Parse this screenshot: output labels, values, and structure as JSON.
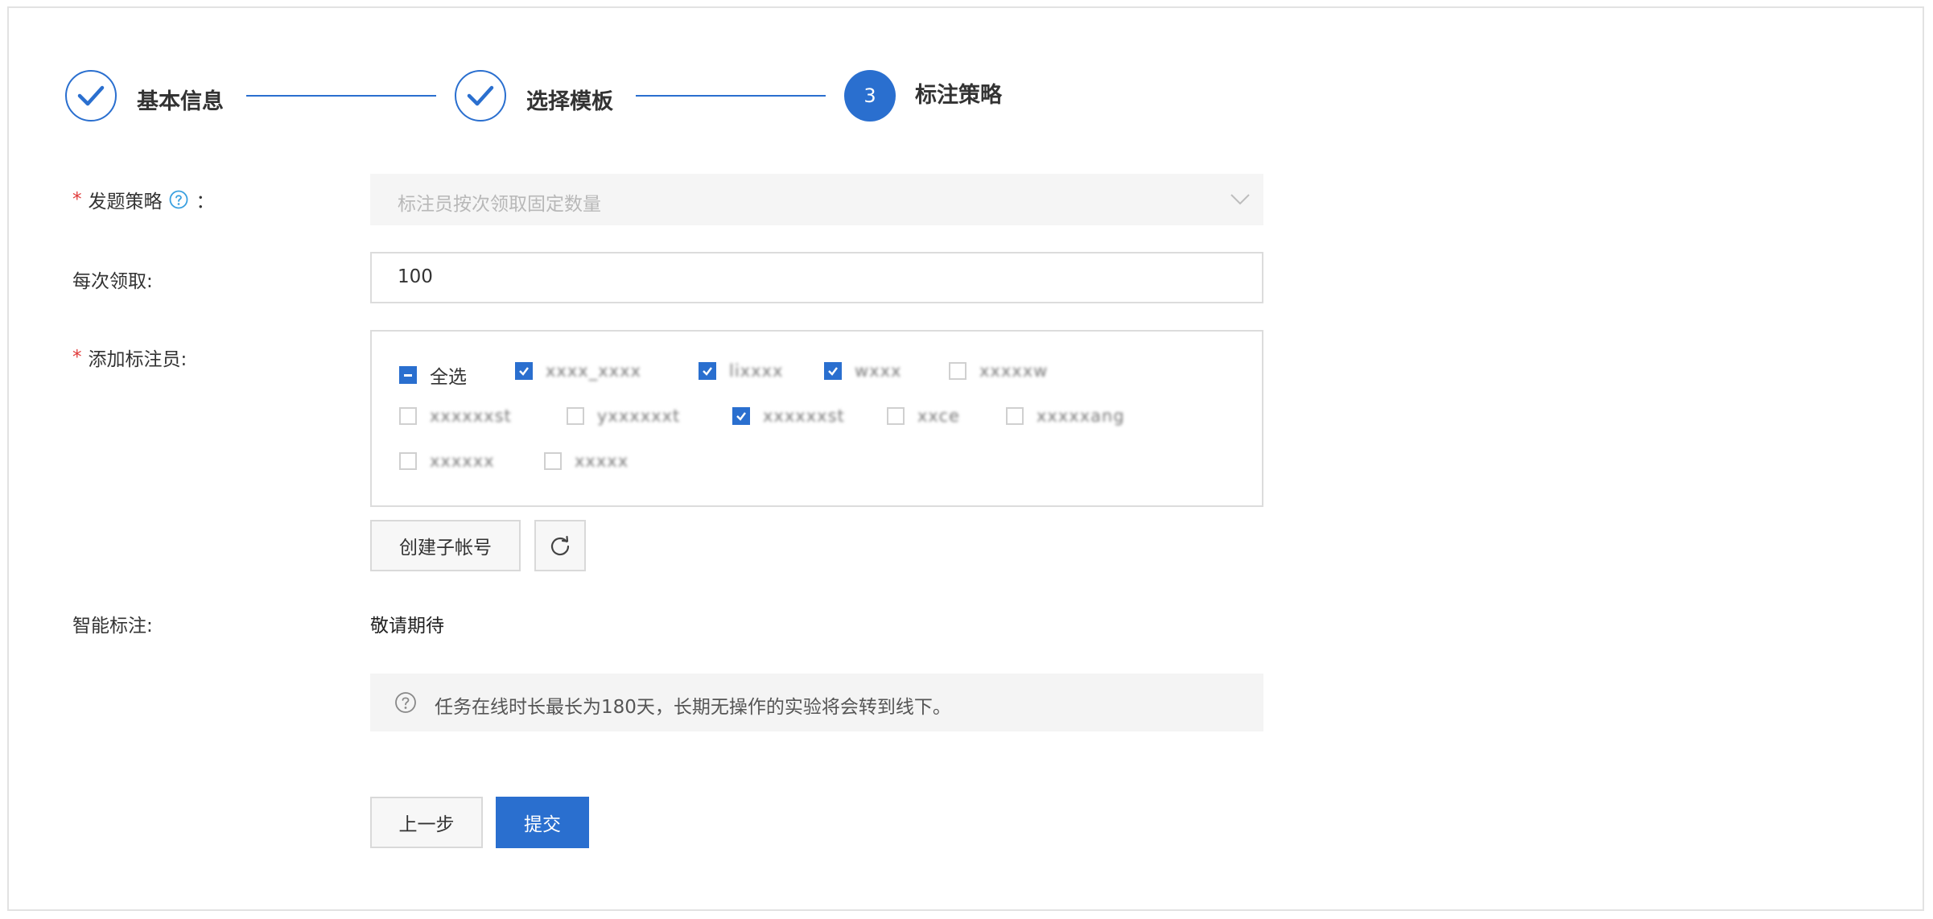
{
  "steps": [
    {
      "label": "基本信息",
      "status": "done"
    },
    {
      "label": "选择模板",
      "status": "done"
    },
    {
      "number": "3",
      "label": "标注策略",
      "status": "active"
    }
  ],
  "form": {
    "dispatch_strategy": {
      "label": "发题策略",
      "required_mark": "*",
      "colon": "：",
      "placeholder": "标注员按次领取固定数量"
    },
    "per_claim": {
      "label": "每次领取:",
      "value": "100"
    },
    "annotators": {
      "label": "添加标注员:",
      "required_mark": "*",
      "select_all": {
        "label": "全选",
        "state": "indeterminate"
      },
      "users": [
        {
          "name": "xxxx_xxxx",
          "checked": true
        },
        {
          "name": "lixxxx",
          "checked": true
        },
        {
          "name": "wxxx",
          "checked": true
        },
        {
          "name": "xxxxxw",
          "checked": false
        },
        {
          "name": "xxxxxxst",
          "checked": false
        },
        {
          "name": "yxxxxxxt",
          "checked": false
        },
        {
          "name": "xxxxxxst",
          "checked": true
        },
        {
          "name": "xxce",
          "checked": false
        },
        {
          "name": "xxxxxang",
          "checked": false
        },
        {
          "name": "xxxxxx",
          "checked": false
        },
        {
          "name": "xxxxx",
          "checked": false
        }
      ],
      "create_sub_account_label": "创建子帐号"
    },
    "smart_labeling": {
      "label": "智能标注:",
      "value": "敬请期待"
    }
  },
  "notice": "任务在线时长最长为180天，长期无操作的实验将会转到线下。",
  "actions": {
    "prev_label": "上一步",
    "submit_label": "提交"
  },
  "colors": {
    "primary": "#2a6fcf",
    "required": "#e03a3a"
  }
}
